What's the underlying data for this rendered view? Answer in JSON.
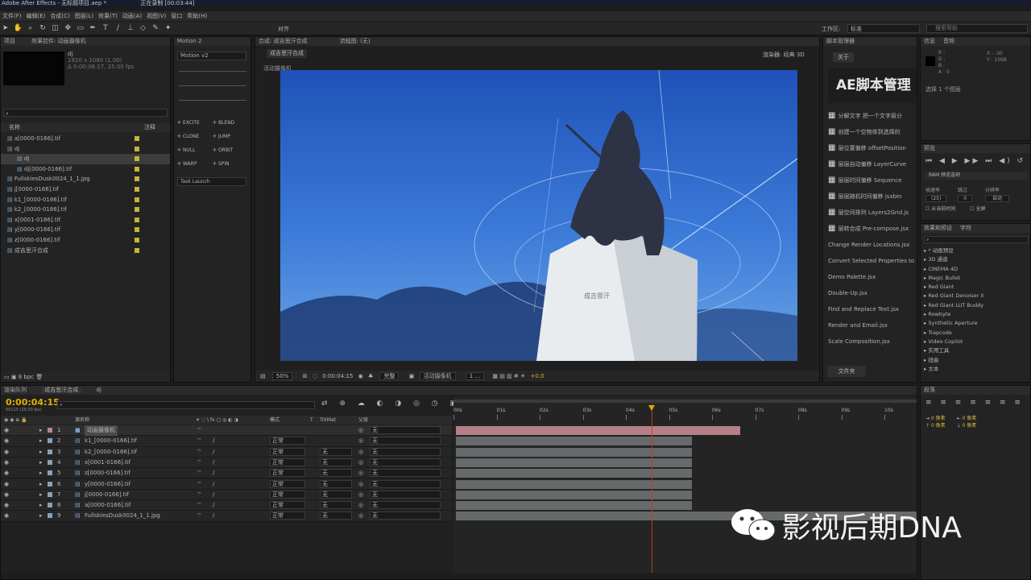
{
  "window": {
    "title": "Adobe After Effects - 无标题项目.aep *",
    "recording": "正在录制 [00:03:44]"
  },
  "menu": [
    "文件(F)",
    "编辑(E)",
    "合成(C)",
    "图层(L)",
    "效果(T)",
    "动画(A)",
    "视图(V)",
    "窗口",
    "帮助(H)"
  ],
  "toolbar": {
    "align": "对齐",
    "workspace_label": "工作区:",
    "workspace_value": "标准",
    "search_placeholder": "搜索帮助"
  },
  "project": {
    "tab": "项目",
    "effects_tab": "效果控件: 动画摄像机",
    "item_name": "dj",
    "item_info1": "1920 x 1080 (1.00)",
    "item_info2": "Δ 0:00:06:17, 25.00 fps",
    "col_name": "名称",
    "col_comment": "注释",
    "bpc": "8 bpc",
    "items": [
      {
        "name": "a[0000-0166].tif",
        "indent": 0
      },
      {
        "name": "dj",
        "indent": 0
      },
      {
        "name": "dj",
        "indent": 1
      },
      {
        "name": "dj[0000-0166].tif",
        "indent": 1
      },
      {
        "name": "FullskiesDusk0024_1_1.jpg",
        "indent": 0
      },
      {
        "name": "j[0000-0166].tif",
        "indent": 0
      },
      {
        "name": "k1_[0000-0166].tif",
        "indent": 0
      },
      {
        "name": "k2_[0000-0166].tif",
        "indent": 0
      },
      {
        "name": "x[0001-0166].tif",
        "indent": 0
      },
      {
        "name": "y[0000-0166].tif",
        "indent": 0
      },
      {
        "name": "z[0000-0166].tif",
        "indent": 0
      },
      {
        "name": "成吉思汗合成",
        "indent": 0
      }
    ]
  },
  "motion": {
    "tab": "Motion 2",
    "version": "Motion v2",
    "buttons": [
      [
        "EXCITE",
        "BLEND"
      ],
      [
        "CLONE",
        "JUMP"
      ],
      [
        "NULL",
        "ORBIT"
      ],
      [
        "WARP",
        "SPIN"
      ]
    ],
    "task": "Task Launch"
  },
  "comp": {
    "tab": "合成: 成吉思汗合成",
    "flow_tab": "流程图: (无)",
    "sub_tab": "成吉思汗合成",
    "renderer": "渲染器:",
    "renderer_value": "经典 3D",
    "camera_label": "活动摄像机",
    "statue_text": "成吉思汗",
    "footer": {
      "zoom": "50%",
      "time": "0:00:04:15",
      "quality": "完整",
      "view": "活动摄像机",
      "views": "1 ...",
      "exposure": "+0.0"
    }
  },
  "scripts": {
    "tab": "脚本管理器",
    "about": "关于",
    "banner": "AE脚本管理",
    "items": [
      "分解文字 把一个文字层分",
      "创建一个空物体到选择的",
      "层位置偏移 offsetPosition",
      "层层自动偏移 LayerCurve",
      "层层时间偏移 Sequence",
      "层层随机时间偏移 jsxbin",
      "层空间排列 Layers2Grid.js",
      "层转合成 Pre-compose.jsx",
      "Change Render Locations.jsx",
      "Convert Selected Properties to",
      "Demo Palette.jsx",
      "Double-Up.jsx",
      "Find and Replace Text.jsx",
      "Render and Email.jsx",
      "Scale Composition.jsx"
    ],
    "open": "文件夹"
  },
  "info": {
    "tab": "信息",
    "audio_tab": "音频",
    "r": "R :",
    "g": "G :",
    "b": "B :",
    "a": "A : 0",
    "x": "X : -30",
    "y": "Y : 1098",
    "selected": "选择 1 个图层"
  },
  "preview": {
    "tab": "预览",
    "ram": "RAM 预览选项",
    "fps_label": "帧速率",
    "skip_label": "跳过",
    "res_label": "分辨率",
    "fps": "(25)",
    "skip": "0",
    "res": "自动",
    "from_current": "从当前时间",
    "fullscreen": "全屏"
  },
  "effects": {
    "tab": "效果和预设",
    "chars_tab": "字符",
    "items": [
      "* 动画预设",
      "3D 通道",
      "CINEMA 4D",
      "Magic Bullet",
      "Red Giant",
      "Red Giant Denoiser II",
      "Red Giant LUT Buddy",
      "Rowbyte",
      "Synthetic Aperture",
      "Trapcode",
      "Video Copilot",
      "实用工具",
      "扭曲",
      "文本"
    ]
  },
  "paragraph": {
    "tab": "段落",
    "v1": "0 像素",
    "v2": "0 像素",
    "v3": "0 像素",
    "v4": "0 像素"
  },
  "timeline": {
    "tab1": "渲染队列",
    "tab2": "成吉思汗合成",
    "tab3": "dj",
    "timecode": "0:00:04:15",
    "frames": "00115 (25.00 fps)",
    "cols": {
      "name": "源名称",
      "mode": "模式",
      "t": "T",
      "trkmat": "TrkMat",
      "parent": "父级"
    },
    "ruler": [
      "00s",
      "01s",
      "02s",
      "03s",
      "04s",
      "05s",
      "06s",
      "07s",
      "08s",
      "09s",
      "10s"
    ],
    "layers": [
      {
        "num": "1",
        "name": "动画摄像机",
        "mode": "",
        "trk": "",
        "parent": "无"
      },
      {
        "num": "2",
        "name": "k1_[0000-0166].tif",
        "mode": "正常",
        "trk": "",
        "parent": "无"
      },
      {
        "num": "3",
        "name": "k2_[0000-0166].tif",
        "mode": "正常",
        "trk": "无",
        "parent": "无"
      },
      {
        "num": "4",
        "name": "x[0001-0166].tif",
        "mode": "正常",
        "trk": "无",
        "parent": "无"
      },
      {
        "num": "5",
        "name": "z[0000-0166].tif",
        "mode": "正常",
        "trk": "无",
        "parent": "无"
      },
      {
        "num": "6",
        "name": "y[0000-0166].tif",
        "mode": "正常",
        "trk": "无",
        "parent": "无"
      },
      {
        "num": "7",
        "name": "j[0000-0166].tif",
        "mode": "正常",
        "trk": "无",
        "parent": "无"
      },
      {
        "num": "8",
        "name": "a[0000-0166].tif",
        "mode": "正常",
        "trk": "无",
        "parent": "无"
      },
      {
        "num": "9",
        "name": "FullskiesDusk0024_1_1.jpg",
        "mode": "正常",
        "trk": "无",
        "parent": "无"
      }
    ]
  },
  "watermark": "影视后期DNA"
}
